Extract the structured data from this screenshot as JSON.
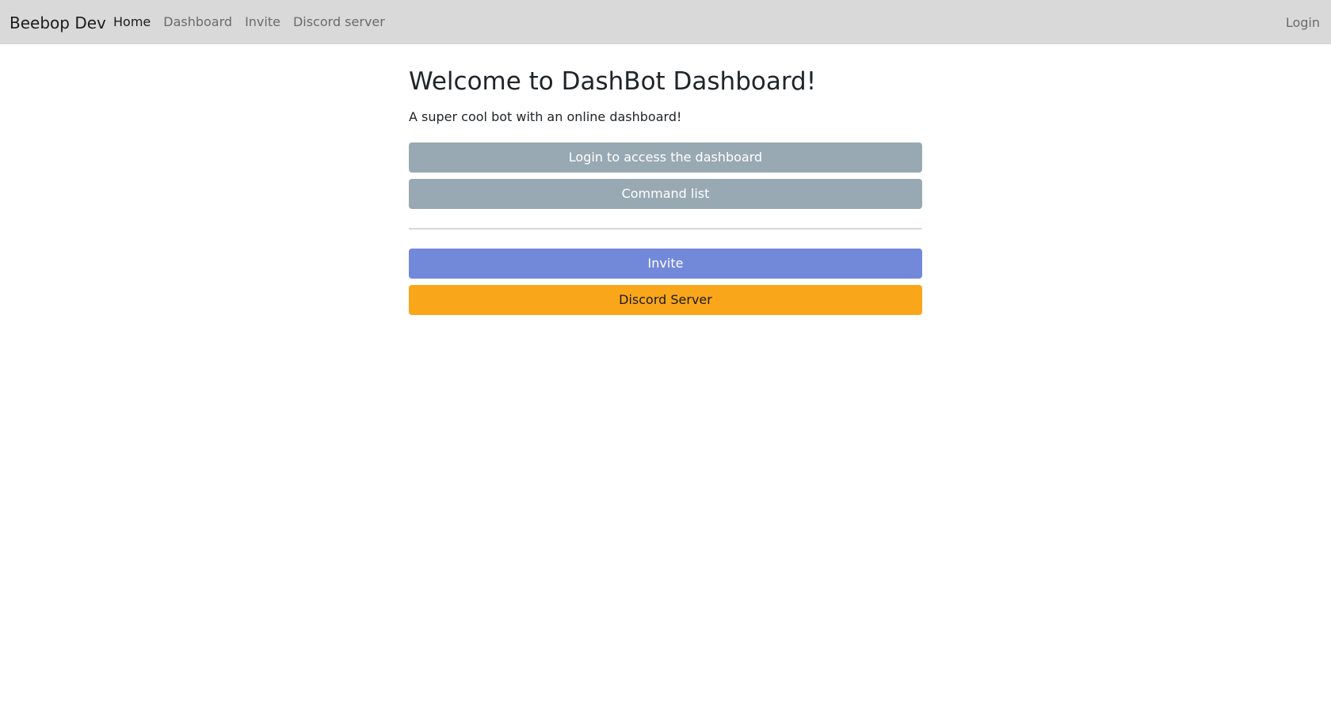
{
  "navbar": {
    "brand": "Beebop Dev",
    "links": [
      {
        "label": "Home"
      },
      {
        "label": "Dashboard"
      },
      {
        "label": "Invite"
      },
      {
        "label": "Discord server"
      }
    ],
    "login_label": "Login",
    "background_color": "#d9d9d9"
  },
  "main": {
    "title": "Welcome to DashBot Dashboard!",
    "subtitle": "A super cool bot with an online dashboard!",
    "buttons": {
      "login_dashboard": "Login to access the dashboard",
      "command_list": "Command list",
      "invite": "Invite",
      "discord_server": "Discord Server"
    }
  },
  "colors": {
    "secondary": "#99a9b3",
    "invite": "#7289da",
    "discord": "#faa61a"
  }
}
